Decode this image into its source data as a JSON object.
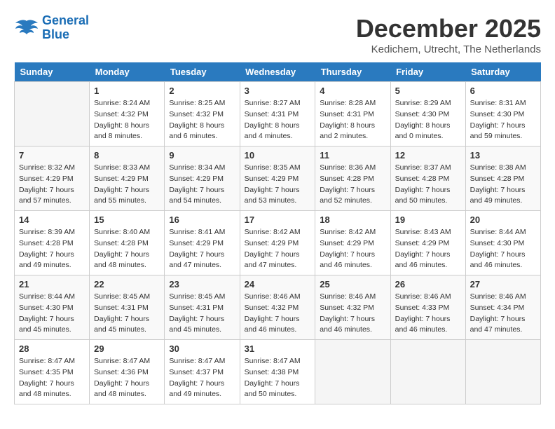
{
  "logo": {
    "line1": "General",
    "line2": "Blue"
  },
  "title": "December 2025",
  "location": "Kedichem, Utrecht, The Netherlands",
  "days_of_week": [
    "Sunday",
    "Monday",
    "Tuesday",
    "Wednesday",
    "Thursday",
    "Friday",
    "Saturday"
  ],
  "weeks": [
    [
      {
        "day": "",
        "info": ""
      },
      {
        "day": "1",
        "info": "Sunrise: 8:24 AM\nSunset: 4:32 PM\nDaylight: 8 hours\nand 8 minutes."
      },
      {
        "day": "2",
        "info": "Sunrise: 8:25 AM\nSunset: 4:32 PM\nDaylight: 8 hours\nand 6 minutes."
      },
      {
        "day": "3",
        "info": "Sunrise: 8:27 AM\nSunset: 4:31 PM\nDaylight: 8 hours\nand 4 minutes."
      },
      {
        "day": "4",
        "info": "Sunrise: 8:28 AM\nSunset: 4:31 PM\nDaylight: 8 hours\nand 2 minutes."
      },
      {
        "day": "5",
        "info": "Sunrise: 8:29 AM\nSunset: 4:30 PM\nDaylight: 8 hours\nand 0 minutes."
      },
      {
        "day": "6",
        "info": "Sunrise: 8:31 AM\nSunset: 4:30 PM\nDaylight: 7 hours\nand 59 minutes."
      }
    ],
    [
      {
        "day": "7",
        "info": "Sunrise: 8:32 AM\nSunset: 4:29 PM\nDaylight: 7 hours\nand 57 minutes."
      },
      {
        "day": "8",
        "info": "Sunrise: 8:33 AM\nSunset: 4:29 PM\nDaylight: 7 hours\nand 55 minutes."
      },
      {
        "day": "9",
        "info": "Sunrise: 8:34 AM\nSunset: 4:29 PM\nDaylight: 7 hours\nand 54 minutes."
      },
      {
        "day": "10",
        "info": "Sunrise: 8:35 AM\nSunset: 4:29 PM\nDaylight: 7 hours\nand 53 minutes."
      },
      {
        "day": "11",
        "info": "Sunrise: 8:36 AM\nSunset: 4:28 PM\nDaylight: 7 hours\nand 52 minutes."
      },
      {
        "day": "12",
        "info": "Sunrise: 8:37 AM\nSunset: 4:28 PM\nDaylight: 7 hours\nand 50 minutes."
      },
      {
        "day": "13",
        "info": "Sunrise: 8:38 AM\nSunset: 4:28 PM\nDaylight: 7 hours\nand 49 minutes."
      }
    ],
    [
      {
        "day": "14",
        "info": "Sunrise: 8:39 AM\nSunset: 4:28 PM\nDaylight: 7 hours\nand 49 minutes."
      },
      {
        "day": "15",
        "info": "Sunrise: 8:40 AM\nSunset: 4:28 PM\nDaylight: 7 hours\nand 48 minutes."
      },
      {
        "day": "16",
        "info": "Sunrise: 8:41 AM\nSunset: 4:29 PM\nDaylight: 7 hours\nand 47 minutes."
      },
      {
        "day": "17",
        "info": "Sunrise: 8:42 AM\nSunset: 4:29 PM\nDaylight: 7 hours\nand 47 minutes."
      },
      {
        "day": "18",
        "info": "Sunrise: 8:42 AM\nSunset: 4:29 PM\nDaylight: 7 hours\nand 46 minutes."
      },
      {
        "day": "19",
        "info": "Sunrise: 8:43 AM\nSunset: 4:29 PM\nDaylight: 7 hours\nand 46 minutes."
      },
      {
        "day": "20",
        "info": "Sunrise: 8:44 AM\nSunset: 4:30 PM\nDaylight: 7 hours\nand 46 minutes."
      }
    ],
    [
      {
        "day": "21",
        "info": "Sunrise: 8:44 AM\nSunset: 4:30 PM\nDaylight: 7 hours\nand 45 minutes."
      },
      {
        "day": "22",
        "info": "Sunrise: 8:45 AM\nSunset: 4:31 PM\nDaylight: 7 hours\nand 45 minutes."
      },
      {
        "day": "23",
        "info": "Sunrise: 8:45 AM\nSunset: 4:31 PM\nDaylight: 7 hours\nand 45 minutes."
      },
      {
        "day": "24",
        "info": "Sunrise: 8:46 AM\nSunset: 4:32 PM\nDaylight: 7 hours\nand 46 minutes."
      },
      {
        "day": "25",
        "info": "Sunrise: 8:46 AM\nSunset: 4:32 PM\nDaylight: 7 hours\nand 46 minutes."
      },
      {
        "day": "26",
        "info": "Sunrise: 8:46 AM\nSunset: 4:33 PM\nDaylight: 7 hours\nand 46 minutes."
      },
      {
        "day": "27",
        "info": "Sunrise: 8:46 AM\nSunset: 4:34 PM\nDaylight: 7 hours\nand 47 minutes."
      }
    ],
    [
      {
        "day": "28",
        "info": "Sunrise: 8:47 AM\nSunset: 4:35 PM\nDaylight: 7 hours\nand 48 minutes."
      },
      {
        "day": "29",
        "info": "Sunrise: 8:47 AM\nSunset: 4:36 PM\nDaylight: 7 hours\nand 48 minutes."
      },
      {
        "day": "30",
        "info": "Sunrise: 8:47 AM\nSunset: 4:37 PM\nDaylight: 7 hours\nand 49 minutes."
      },
      {
        "day": "31",
        "info": "Sunrise: 8:47 AM\nSunset: 4:38 PM\nDaylight: 7 hours\nand 50 minutes."
      },
      {
        "day": "",
        "info": ""
      },
      {
        "day": "",
        "info": ""
      },
      {
        "day": "",
        "info": ""
      }
    ]
  ]
}
